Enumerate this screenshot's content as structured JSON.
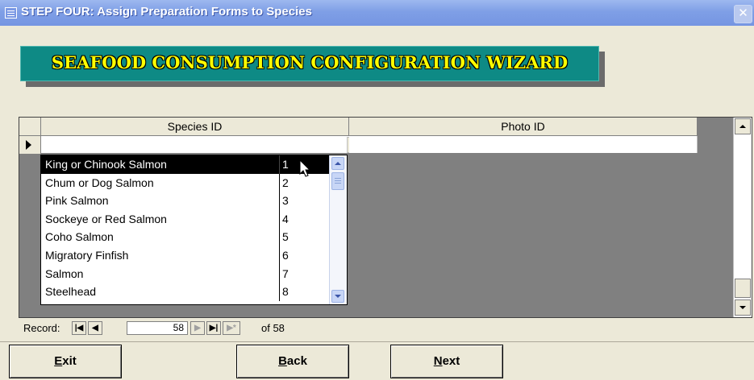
{
  "window": {
    "title": "STEP FOUR:  Assign Preparation Forms to Species",
    "close": "✕"
  },
  "banner": {
    "text": "SEAFOOD CONSUMPTION CONFIGURATION WIZARD"
  },
  "grid": {
    "columns": [
      "Species ID",
      "Photo ID"
    ],
    "current_row": {
      "species_id": "",
      "photo_id": ""
    }
  },
  "dropdown": {
    "items": [
      {
        "name": "King or Chinook Salmon",
        "id": "1"
      },
      {
        "name": "Chum or Dog Salmon",
        "id": "2"
      },
      {
        "name": "Pink Salmon",
        "id": "3"
      },
      {
        "name": "Sockeye or Red Salmon",
        "id": "4"
      },
      {
        "name": "Coho Salmon",
        "id": "5"
      },
      {
        "name": "Migratory Finfish",
        "id": "6"
      },
      {
        "name": "Salmon",
        "id": "7"
      },
      {
        "name": "Steelhead",
        "id": "8"
      }
    ],
    "selected_index": 0
  },
  "record_nav": {
    "label": "Record:",
    "current": "58",
    "of_text": "of 58",
    "first": "|◀",
    "prev": "◀",
    "next": "▶",
    "last": "▶|",
    "new": "▶*"
  },
  "buttons": {
    "exit": {
      "key": "E",
      "rest": "xit"
    },
    "back": {
      "key": "B",
      "rest": "ack"
    },
    "next": {
      "key": "N",
      "rest": "ext"
    }
  }
}
